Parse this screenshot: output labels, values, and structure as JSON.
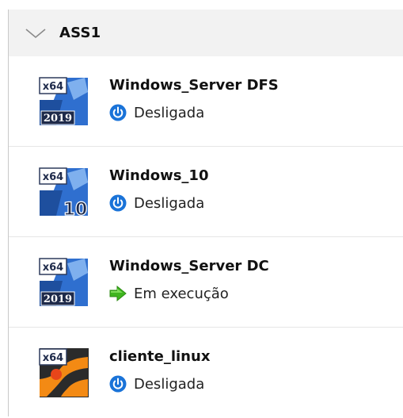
{
  "group": {
    "title": "ASS1",
    "chevron_icon": "chevron-down-icon"
  },
  "colors": {
    "header_bg": "#f2f2f2",
    "power_blue": "#1a73d8",
    "running_green": "#3fb51f",
    "os_badge_dark": "#1e2a4a",
    "os_badge_blue": "#2f6fcf",
    "linux_orange": "#f38a14"
  },
  "machines": [
    {
      "name": "Windows_Server DFS",
      "status": "Desligada",
      "status_icon": "power-icon",
      "os_arch": "x64",
      "os_badge": "2019",
      "os_type": "windows-server"
    },
    {
      "name": "Windows_10",
      "status": "Desligada",
      "status_icon": "power-icon",
      "os_arch": "x64",
      "os_badge": "10",
      "os_type": "windows-10"
    },
    {
      "name": "Windows_Server DC",
      "status": "Em execução",
      "status_icon": "running-arrow-icon",
      "os_arch": "x64",
      "os_badge": "2019",
      "os_type": "windows-server"
    },
    {
      "name": "cliente_linux",
      "status": "Desligada",
      "status_icon": "power-icon",
      "os_arch": "x64",
      "os_badge": "",
      "os_type": "linux"
    }
  ]
}
